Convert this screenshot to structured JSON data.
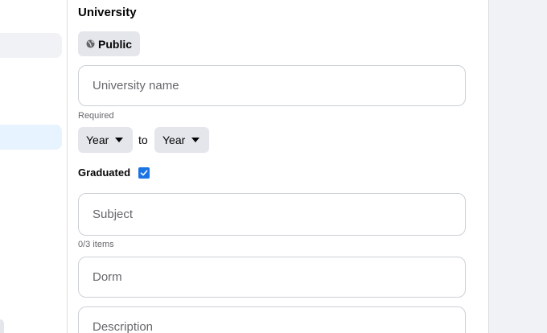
{
  "section": {
    "title": "University"
  },
  "privacy": {
    "label": "Public",
    "icon": "globe-icon"
  },
  "university_field": {
    "placeholder": "University name",
    "value": "",
    "helper": "Required"
  },
  "years": {
    "from_label": "Year",
    "to_separator": "to",
    "to_label": "Year"
  },
  "graduated": {
    "label": "Graduated",
    "checked": true
  },
  "subject_field": {
    "placeholder": "Subject",
    "value": "",
    "helper": "0/3 items"
  },
  "dorm_field": {
    "placeholder": "Dorm",
    "value": ""
  },
  "description_field": {
    "placeholder": "Description",
    "value": ""
  },
  "colors": {
    "accent": "#1b74e4",
    "button_bg": "#e4e6eb",
    "active_item_bg": "#e7f3ff",
    "border": "#ccd0d5"
  }
}
